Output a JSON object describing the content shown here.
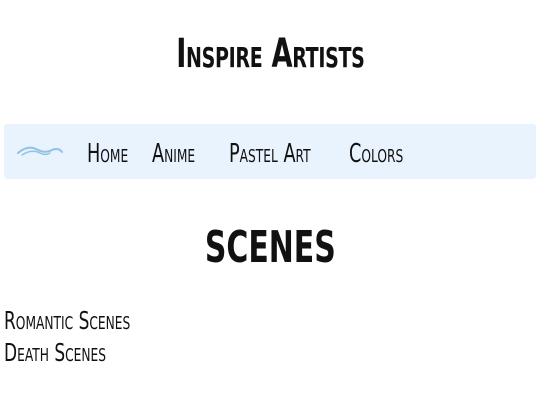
{
  "site": {
    "title": "Inspire Artists"
  },
  "nav": {
    "logo_icon": "brush-stroke-icon",
    "items": [
      {
        "label": "Home"
      },
      {
        "label": "Anime"
      },
      {
        "label": "Pastel Art"
      },
      {
        "label": "Colors"
      }
    ]
  },
  "main": {
    "heading": "SCENES",
    "links": [
      {
        "label": "Romantic Scenes"
      },
      {
        "label": "Death Scenes"
      }
    ]
  },
  "colors": {
    "nav_background": "#e8f3fd",
    "logo_stroke": "#8fc3e3",
    "text": "#111111"
  }
}
